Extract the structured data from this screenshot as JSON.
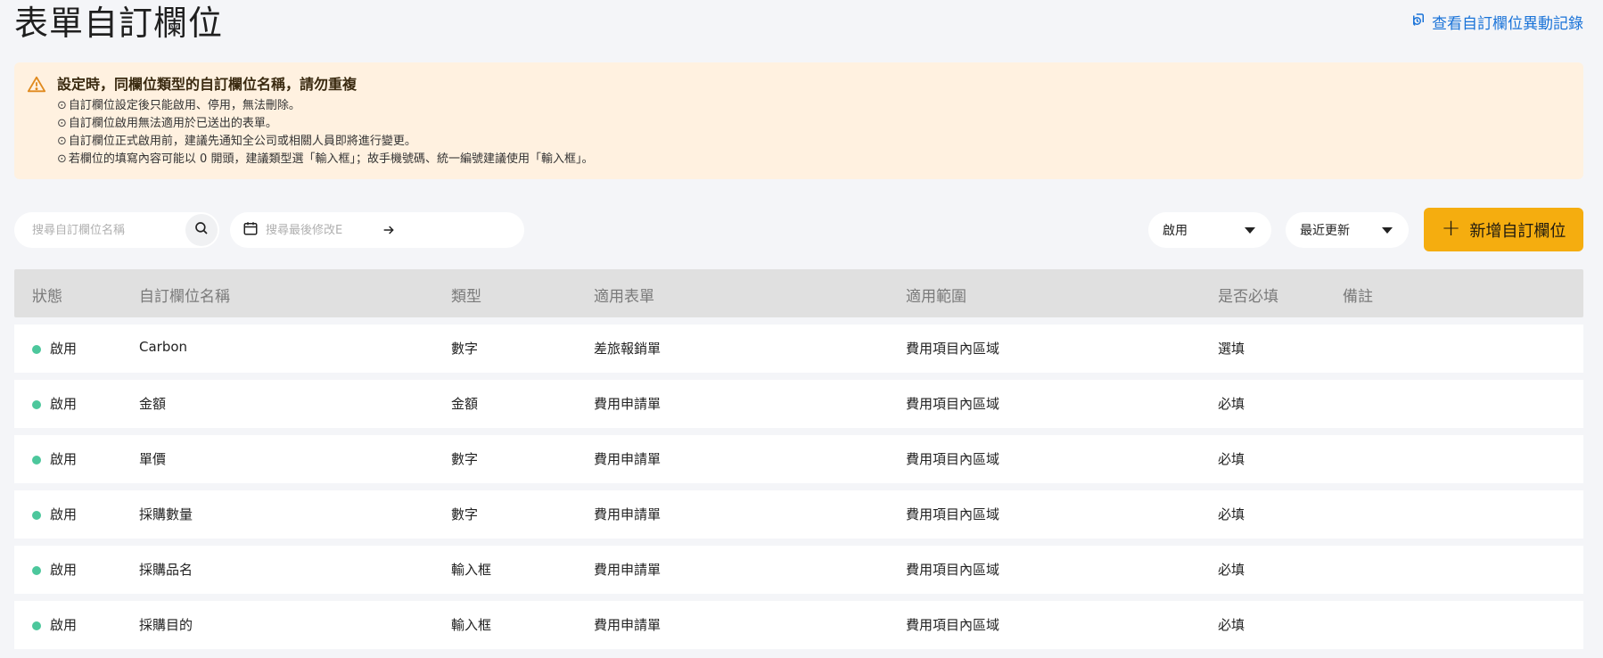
{
  "header": {
    "title": "表單自訂欄位",
    "history_link": "查看自訂欄位異動記錄"
  },
  "notice": {
    "title": "設定時，同欄位類型的自訂欄位名稱，請勿重複",
    "items": [
      "自訂欄位設定後只能啟用、停用，無法刪除。",
      "自訂欄位啟用無法適用於已送出的表單。",
      "自訂欄位正式啟用前，建議先通知全公司或相關人員即將進行變更。",
      "若欄位的填寫內容可能以 0 開頭，建議類型選「輸入框」；故手機號碼、統一編號建議使用「輸入框」。"
    ]
  },
  "filters": {
    "search_placeholder": "搜尋自訂欄位名稱",
    "date_placeholder": "搜尋最後修改E",
    "status_value": "啟用",
    "sort_value": "最近更新",
    "add_button": "新增自訂欄位"
  },
  "table": {
    "headers": {
      "status": "狀態",
      "name": "自訂欄位名稱",
      "type": "類型",
      "form": "適用表單",
      "scope": "適用範圍",
      "required": "是否必填",
      "note": "備註"
    },
    "status_color": "#4cc79c",
    "rows": [
      {
        "status": "啟用",
        "name": "Carbon",
        "type": "數字",
        "form": "差旅報銷單",
        "scope": "費用項目內區域",
        "required": "選填"
      },
      {
        "status": "啟用",
        "name": "金額",
        "type": "金額",
        "form": "費用申請單",
        "scope": "費用項目內區域",
        "required": "必填"
      },
      {
        "status": "啟用",
        "name": "單價",
        "type": "數字",
        "form": "費用申請單",
        "scope": "費用項目內區域",
        "required": "必填"
      },
      {
        "status": "啟用",
        "name": "採購數量",
        "type": "數字",
        "form": "費用申請單",
        "scope": "費用項目內區域",
        "required": "必填"
      },
      {
        "status": "啟用",
        "name": "採購品名",
        "type": "輸入框",
        "form": "費用申請單",
        "scope": "費用項目內區域",
        "required": "必填"
      },
      {
        "status": "啟用",
        "name": "採購目的",
        "type": "輸入框",
        "form": "費用申請單",
        "scope": "費用項目內區域",
        "required": "必填"
      }
    ]
  },
  "colors": {
    "accent": "#f5ad0f",
    "link": "#1a73d8",
    "notice_bg": "#fff1e0",
    "warning_icon": "#e08a1e"
  }
}
